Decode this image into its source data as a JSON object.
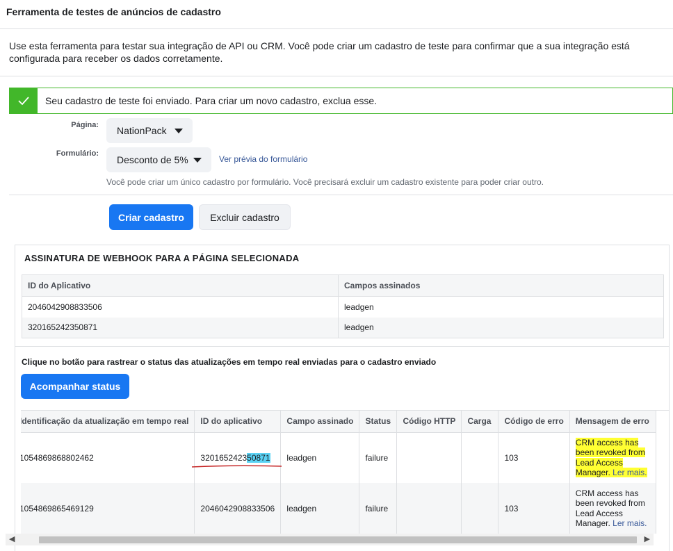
{
  "header": {
    "title": "Ferramenta de testes de anúncios de cadastro"
  },
  "intro": {
    "text": "Use esta ferramenta para testar sua integração de API ou CRM. Você pode criar um cadastro de teste para confirmar que a sua integração está configurada para receber os dados corretamente."
  },
  "alert": {
    "text": "Seu cadastro de teste foi enviado. Para criar um novo cadastro, exclua esse.",
    "icon": "check-icon",
    "color": "#42b72a"
  },
  "form": {
    "page_label": "Página:",
    "page_value": "NationPack",
    "form_label": "Formulário:",
    "form_value": "Desconto de 5%",
    "preview_link": "Ver prévia do formulário",
    "hint": "Você pode criar um único cadastro por formulário. Você precisará excluir um cadastro existente para poder criar outro."
  },
  "buttons": {
    "create": "Criar cadastro",
    "delete": "Excluir cadastro",
    "track": "Acompanhar status",
    "primary_color": "#1877f2"
  },
  "webhook": {
    "title": "ASSINATURA DE WEBHOOK PARA A PÁGINA SELECIONADA",
    "columns": [
      "ID do Aplicativo",
      "Campos assinados"
    ],
    "rows": [
      [
        "2046042908833506",
        "leadgen"
      ],
      [
        "320165242350871",
        "leadgen"
      ]
    ]
  },
  "tracking": {
    "text": "Clique no botão para rastrear o status das atualizações em tempo real enviadas para o cadastro enviado",
    "columns": [
      "Identificação da atualização em tempo real",
      "ID do aplicativo",
      "Campo assinado",
      "Status",
      "Código HTTP",
      "Carga",
      "Código de erro",
      "Mensagem de erro"
    ],
    "rows": [
      {
        "update_id": "1054869868802462",
        "app_id_prefix": "3201652423",
        "app_id_highlight": "50871",
        "field": "leadgen",
        "status": "failure",
        "http": "",
        "payload": "",
        "error_code": "103",
        "error_lines": [
          "CRM access has",
          "been revoked from",
          "Lead Access",
          "Manager."
        ],
        "more": "Ler mais."
      },
      {
        "update_id": "1054869865469129",
        "app_id": "2046042908833506",
        "field": "leadgen",
        "status": "failure",
        "http": "",
        "payload": "",
        "error_code": "103",
        "error_lines": [
          "CRM access has",
          "been revoked from",
          "Lead Access",
          "Manager."
        ],
        "more": "Ler mais."
      }
    ]
  }
}
